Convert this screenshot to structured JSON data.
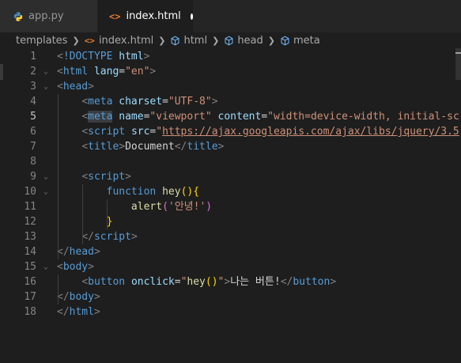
{
  "tabs": [
    {
      "label": "app.py",
      "icon": "python-icon",
      "active": false
    },
    {
      "label": "index.html",
      "icon": "html-icon",
      "active": true,
      "modified": true
    }
  ],
  "breadcrumb": {
    "items": [
      {
        "label": "templates",
        "icon": ""
      },
      {
        "label": "index.html",
        "icon": "html-icon"
      },
      {
        "label": "html",
        "icon": "cube-icon"
      },
      {
        "label": "head",
        "icon": "cube-icon"
      },
      {
        "label": "meta",
        "icon": "cube-icon"
      }
    ]
  },
  "editor": {
    "current_line": 5,
    "line_numbers": [
      "1",
      "2",
      "3",
      "4",
      "5",
      "6",
      "7",
      "8",
      "9",
      "10",
      "11",
      "12",
      "13",
      "14",
      "15",
      "16",
      "17",
      "18"
    ],
    "lines": [
      [
        [
          "br",
          "<"
        ],
        [
          "tag",
          "!DOCTYPE"
        ],
        [
          "txt",
          " "
        ],
        [
          "attr",
          "html"
        ],
        [
          "br",
          ">"
        ]
      ],
      [
        [
          "br",
          "<"
        ],
        [
          "tag",
          "html"
        ],
        [
          "txt",
          " "
        ],
        [
          "attr",
          "lang"
        ],
        [
          "txt",
          "="
        ],
        [
          "str",
          "\"en\""
        ],
        [
          "br",
          ">"
        ]
      ],
      [
        [
          "br",
          "<"
        ],
        [
          "tag",
          "head"
        ],
        [
          "br",
          ">"
        ]
      ],
      [
        [
          "txt",
          "    "
        ],
        [
          "br",
          "<"
        ],
        [
          "tag",
          "meta"
        ],
        [
          "txt",
          " "
        ],
        [
          "attr",
          "charset"
        ],
        [
          "txt",
          "="
        ],
        [
          "str",
          "\"UTF-8\""
        ],
        [
          "br",
          ">"
        ]
      ],
      [
        [
          "txt",
          "    "
        ],
        [
          "br",
          "<"
        ],
        [
          "taghl",
          "meta"
        ],
        [
          "txt",
          " "
        ],
        [
          "attr",
          "name"
        ],
        [
          "txt",
          "="
        ],
        [
          "str",
          "\"viewport\""
        ],
        [
          "txt",
          " "
        ],
        [
          "attr",
          "content"
        ],
        [
          "txt",
          "="
        ],
        [
          "str",
          "\"width=device-width, initial-sc"
        ]
      ],
      [
        [
          "txt",
          "    "
        ],
        [
          "br",
          "<"
        ],
        [
          "tag",
          "script"
        ],
        [
          "txt",
          " "
        ],
        [
          "attr",
          "src"
        ],
        [
          "txt",
          "="
        ],
        [
          "str",
          "\""
        ],
        [
          "strlink",
          "https://ajax.googleapis.com/ajax/libs/jquery/3.5"
        ]
      ],
      [
        [
          "txt",
          "    "
        ],
        [
          "br",
          "<"
        ],
        [
          "tag",
          "title"
        ],
        [
          "br",
          ">"
        ],
        [
          "txt",
          "Document"
        ],
        [
          "br",
          "</"
        ],
        [
          "tag",
          "title"
        ],
        [
          "br",
          ">"
        ]
      ],
      [],
      [
        [
          "txt",
          "    "
        ],
        [
          "br",
          "<"
        ],
        [
          "tag",
          "script"
        ],
        [
          "br",
          ">"
        ]
      ],
      [
        [
          "txt",
          "        "
        ],
        [
          "kw",
          "function"
        ],
        [
          "txt",
          " "
        ],
        [
          "fn",
          "hey"
        ],
        [
          "p1",
          "()"
        ],
        [
          "p1",
          "{"
        ]
      ],
      [
        [
          "txt",
          "            "
        ],
        [
          "fn",
          "alert"
        ],
        [
          "p2",
          "("
        ],
        [
          "str",
          "'안녕!'"
        ],
        [
          "p2",
          ")"
        ]
      ],
      [
        [
          "txt",
          "        "
        ],
        [
          "p1",
          "}"
        ]
      ],
      [
        [
          "txt",
          "    "
        ],
        [
          "br",
          "</"
        ],
        [
          "tag",
          "script"
        ],
        [
          "br",
          ">"
        ]
      ],
      [
        [
          "br",
          "</"
        ],
        [
          "tag",
          "head"
        ],
        [
          "br",
          ">"
        ]
      ],
      [
        [
          "br",
          "<"
        ],
        [
          "tag",
          "body"
        ],
        [
          "br",
          ">"
        ]
      ],
      [
        [
          "txt",
          "    "
        ],
        [
          "br",
          "<"
        ],
        [
          "tag",
          "button"
        ],
        [
          "txt",
          " "
        ],
        [
          "attr",
          "onclick"
        ],
        [
          "txt",
          "="
        ],
        [
          "str",
          "\""
        ],
        [
          "fn",
          "hey"
        ],
        [
          "p1",
          "()"
        ],
        [
          "str",
          "\""
        ],
        [
          "br",
          ">"
        ],
        [
          "txt",
          "나는 버튼!"
        ],
        [
          "br",
          "</"
        ],
        [
          "tag",
          "button"
        ],
        [
          "br",
          ">"
        ]
      ],
      [
        [
          "br",
          "</"
        ],
        [
          "tag",
          "body"
        ],
        [
          "br",
          ">"
        ]
      ],
      [
        [
          "br",
          "</"
        ],
        [
          "tag",
          "html"
        ],
        [
          "br",
          ">"
        ]
      ]
    ],
    "fold_markers": {
      "2": "⌄",
      "3": "⌄",
      "9": "⌄",
      "10": "⌄",
      "15": "⌄"
    }
  }
}
